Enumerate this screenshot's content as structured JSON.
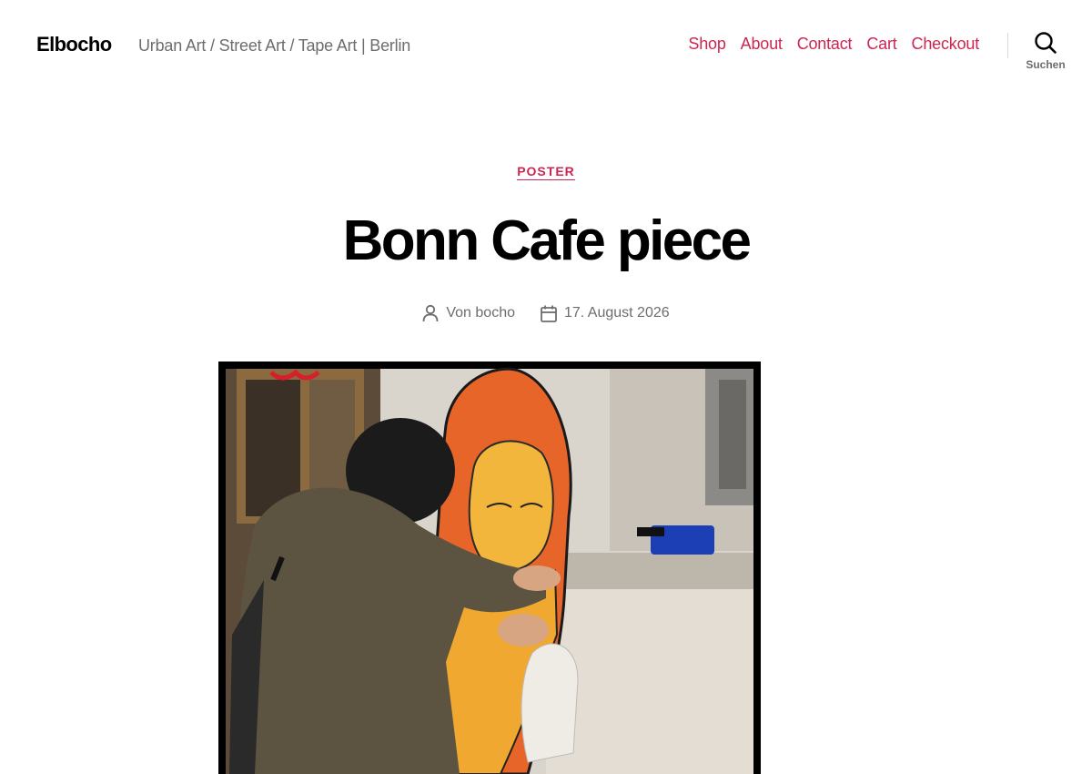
{
  "site": {
    "title": "Elbocho",
    "description": "Urban Art / Street Art / Tape Art | Berlin"
  },
  "nav": {
    "items": [
      {
        "label": "Shop"
      },
      {
        "label": "About"
      },
      {
        "label": "Contact"
      },
      {
        "label": "Cart"
      },
      {
        "label": "Checkout"
      }
    ]
  },
  "search": {
    "label": "Suchen",
    "icon": "search-icon"
  },
  "post": {
    "category": "POSTER",
    "title": "Bonn Cafe piece",
    "author": "Von bocho",
    "date": "17. August 2026",
    "author_icon": "user-icon",
    "date_icon": "calendar-icon"
  },
  "colors": {
    "accent": "#cd2653",
    "secondary_text": "#6d6d6d",
    "background": "#ffffff"
  }
}
